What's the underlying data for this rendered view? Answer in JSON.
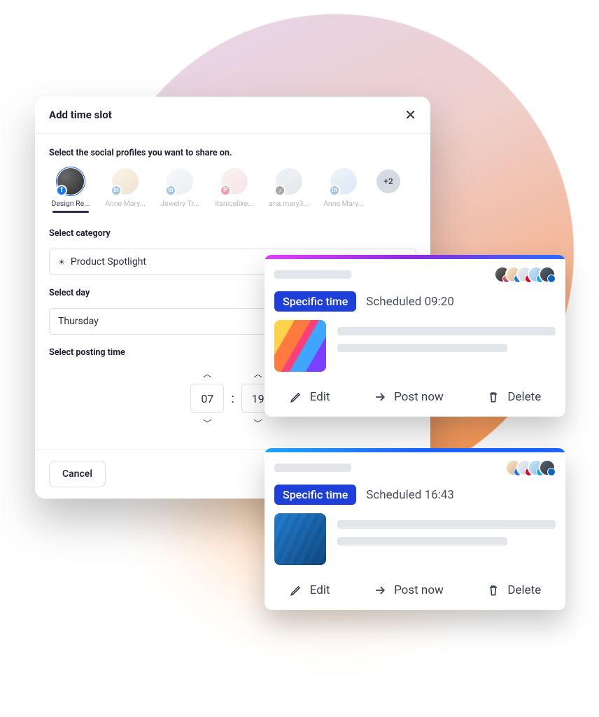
{
  "modal": {
    "title": "Add time slot",
    "section_profiles": "Select the social profiles you want to share on.",
    "profiles": [
      {
        "label": "Design Re...",
        "network": "fb",
        "active": true
      },
      {
        "label": "Anne Mary...",
        "network": "li",
        "active": false
      },
      {
        "label": "Jewelry Tr...",
        "network": "li",
        "active": false
      },
      {
        "label": "itsnicelike...",
        "network": "pi",
        "active": false
      },
      {
        "label": "ana.mary3...",
        "network": "tk",
        "active": false
      },
      {
        "label": "Anne Mary...",
        "network": "li",
        "active": false
      }
    ],
    "more_profiles": "+2",
    "category_label": "Select category",
    "category_value": "Product Spotlight",
    "day_label": "Select day",
    "day_value": "Thursday",
    "time_label": "Select posting time",
    "time_hour": "07",
    "time_minute": "19",
    "cancel": "Cancel"
  },
  "cards": {
    "a": {
      "pill": "Specific time",
      "scheduled": "Scheduled 09:20",
      "edit": "Edit",
      "postnow": "Post now",
      "delete": "Delete"
    },
    "b": {
      "pill": "Specific time",
      "scheduled": "Scheduled 16:43",
      "edit": "Edit",
      "postnow": "Post now",
      "delete": "Delete"
    }
  }
}
